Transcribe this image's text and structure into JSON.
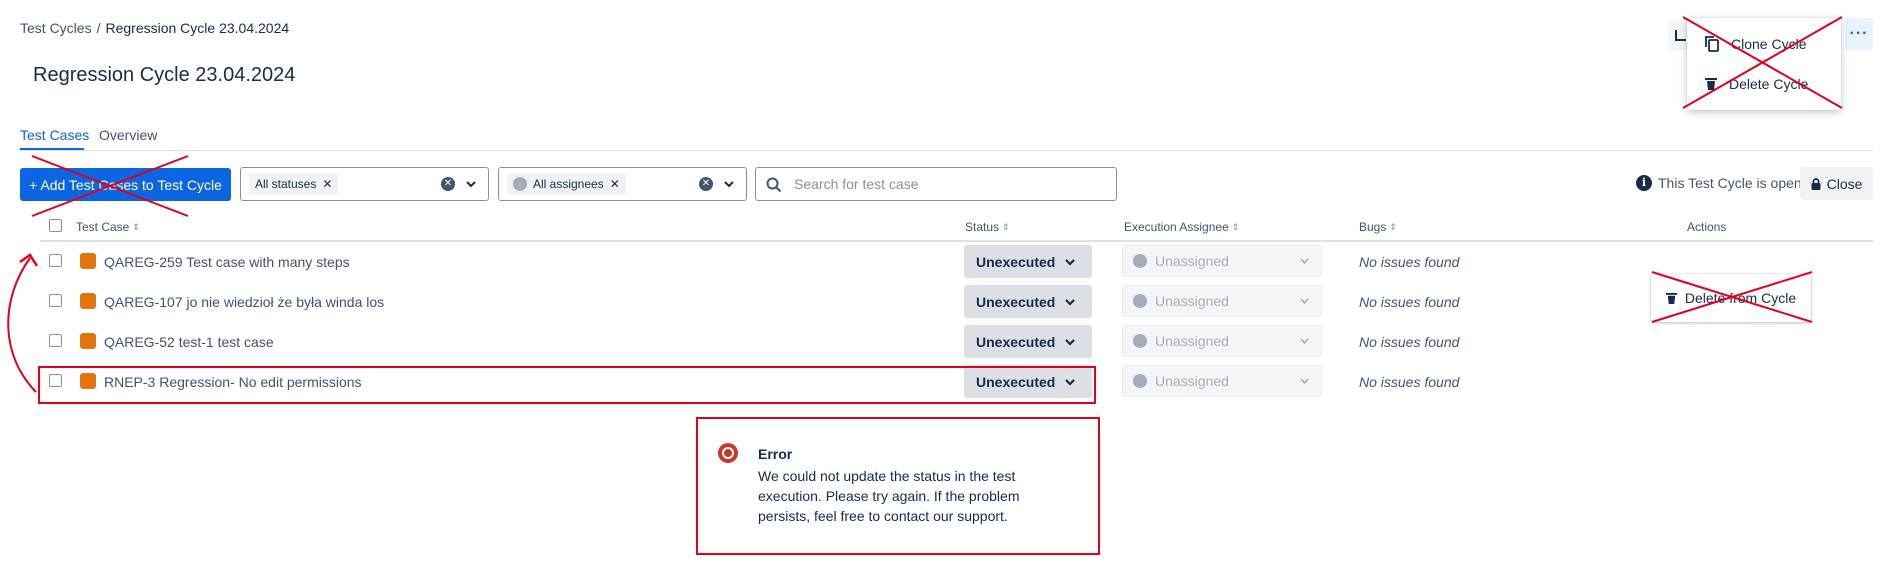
{
  "breadcrumb": {
    "parent": "Test Cycles",
    "separator": "/",
    "current": "Regression Cycle 23.04.2024"
  },
  "page_title": "Regression Cycle 23.04.2024",
  "menu": {
    "items": [
      {
        "label": "Clone Cycle",
        "icon": "copy-icon"
      },
      {
        "label": "Delete Cycle",
        "icon": "trash-icon"
      }
    ]
  },
  "more_button": {
    "label": "···",
    "icon": "more-icon"
  },
  "tabs": [
    {
      "label": "Test Cases",
      "active": true
    },
    {
      "label": "Overview",
      "active": false
    }
  ],
  "toolbar": {
    "add_button": "+ Add Test Cases to Test Cycle",
    "status_filter": {
      "chip": "All statuses"
    },
    "assignee_filter": {
      "chip": "All assignees"
    },
    "search_placeholder": "Search for test case",
    "open_status": "This Test Cycle is open",
    "close_button": "Close"
  },
  "table": {
    "columns": [
      "Test Case",
      "Status",
      "Execution Assignee",
      "Bugs",
      "Actions"
    ],
    "rows": [
      {
        "label": "QAREG-259 Test case with many steps",
        "status": "Unexecuted",
        "assignee": "Unassigned",
        "bugs": "No issues found"
      },
      {
        "label": "QAREG-107 jo nie wiedzioł że była winda los",
        "status": "Unexecuted",
        "assignee": "Unassigned",
        "bugs": "No issues found"
      },
      {
        "label": "QAREG-52 test-1 test case",
        "status": "Unexecuted",
        "assignee": "Unassigned",
        "bugs": "No issues found"
      },
      {
        "label": "RNEP-3 Regression- No edit permissions",
        "status": "Unexecuted",
        "assignee": "Unassigned",
        "bugs": "No issues found"
      }
    ],
    "row_action": "Delete from Cycle"
  },
  "error": {
    "title": "Error",
    "message": "We could not update the status in the test execution. Please try again. If the problem persists, feel free to contact our support."
  },
  "colors": {
    "accent": "#0c66e4",
    "annotation": "#e2001a",
    "issue_icon": "#e2740e",
    "error": "#c9372c"
  }
}
